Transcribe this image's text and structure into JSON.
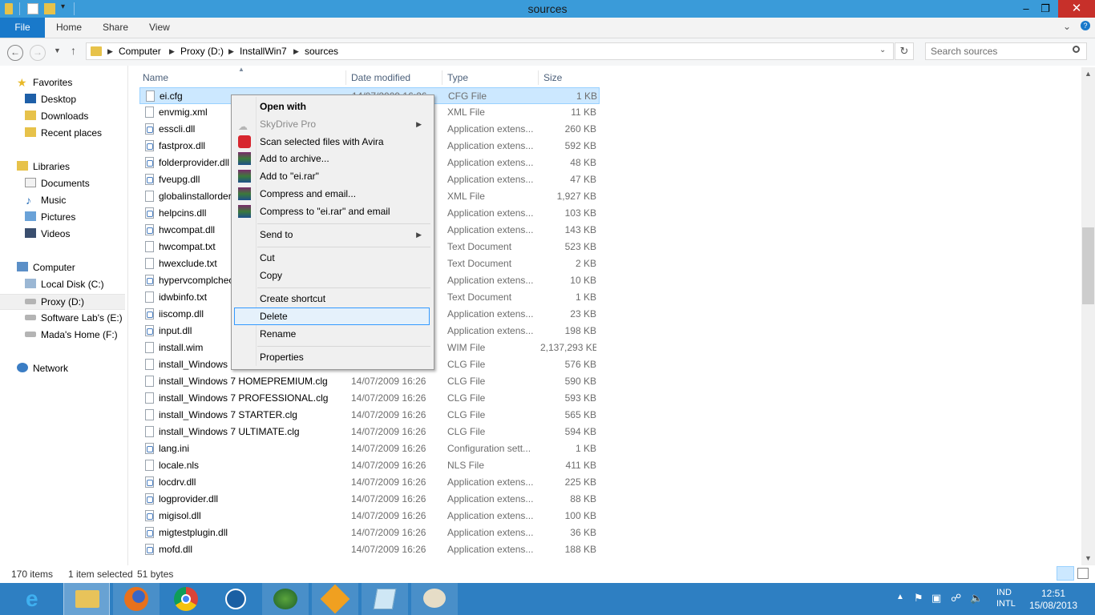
{
  "window": {
    "title": "sources"
  },
  "ribbon": {
    "tabs": [
      "File",
      "Home",
      "Share",
      "View"
    ]
  },
  "address": {
    "crumbs": [
      "Computer",
      "Proxy (D:)",
      "InstallWin7",
      "sources"
    ],
    "search_placeholder": "Search sources"
  },
  "nav": {
    "favorites_label": "Favorites",
    "favorites": [
      "Desktop",
      "Downloads",
      "Recent places"
    ],
    "libraries_label": "Libraries",
    "libraries": [
      "Documents",
      "Music",
      "Pictures",
      "Videos"
    ],
    "computer_label": "Computer",
    "drives": [
      "Local Disk (C:)",
      "Proxy (D:)",
      "Software Lab's (E:)",
      "Mada's Home (F:)"
    ],
    "network_label": "Network"
  },
  "columns": {
    "name": "Name",
    "date": "Date modified",
    "type": "Type",
    "size": "Size"
  },
  "files": [
    {
      "name": "ei.cfg",
      "date": "14/07/2009 16:26",
      "type": "CFG File",
      "size": "1 KB",
      "icon": "doc"
    },
    {
      "name": "envmig.xml",
      "date": "",
      "type": "XML File",
      "size": "11 KB",
      "icon": "doc"
    },
    {
      "name": "esscli.dll",
      "date": "",
      "type": "Application extens...",
      "size": "260 KB",
      "icon": "app"
    },
    {
      "name": "fastprox.dll",
      "date": "",
      "type": "Application extens...",
      "size": "592 KB",
      "icon": "app"
    },
    {
      "name": "folderprovider.dll",
      "date": "",
      "type": "Application extens...",
      "size": "48 KB",
      "icon": "app"
    },
    {
      "name": "fveupg.dll",
      "date": "",
      "type": "Application extens...",
      "size": "47 KB",
      "icon": "app"
    },
    {
      "name": "globalinstallorder.xml",
      "date": "",
      "type": "XML File",
      "size": "1,927 KB",
      "icon": "doc"
    },
    {
      "name": "helpcins.dll",
      "date": "",
      "type": "Application extens...",
      "size": "103 KB",
      "icon": "app"
    },
    {
      "name": "hwcompat.dll",
      "date": "",
      "type": "Application extens...",
      "size": "143 KB",
      "icon": "app"
    },
    {
      "name": "hwcompat.txt",
      "date": "",
      "type": "Text Document",
      "size": "523 KB",
      "icon": "doc"
    },
    {
      "name": "hwexclude.txt",
      "date": "",
      "type": "Text Document",
      "size": "2 KB",
      "icon": "doc"
    },
    {
      "name": "hypervcomplcheck.dll",
      "date": "",
      "type": "Application extens...",
      "size": "10 KB",
      "icon": "app"
    },
    {
      "name": "idwbinfo.txt",
      "date": "",
      "type": "Text Document",
      "size": "1 KB",
      "icon": "doc"
    },
    {
      "name": "iiscomp.dll",
      "date": "",
      "type": "Application extens...",
      "size": "23 KB",
      "icon": "app"
    },
    {
      "name": "input.dll",
      "date": "",
      "type": "Application extens...",
      "size": "198 KB",
      "icon": "app"
    },
    {
      "name": "install.wim",
      "date": "",
      "type": "WIM File",
      "size": "2,137,293 KB",
      "icon": "doc"
    },
    {
      "name": "install_Windows 7 HOMEBASIC.clg",
      "date": "",
      "type": "CLG File",
      "size": "576 KB",
      "icon": "doc"
    },
    {
      "name": "install_Windows 7 HOMEPREMIUM.clg",
      "date": "14/07/2009 16:26",
      "type": "CLG File",
      "size": "590 KB",
      "icon": "doc"
    },
    {
      "name": "install_Windows 7 PROFESSIONAL.clg",
      "date": "14/07/2009 16:26",
      "type": "CLG File",
      "size": "593 KB",
      "icon": "doc"
    },
    {
      "name": "install_Windows 7 STARTER.clg",
      "date": "14/07/2009 16:26",
      "type": "CLG File",
      "size": "565 KB",
      "icon": "doc"
    },
    {
      "name": "install_Windows 7 ULTIMATE.clg",
      "date": "14/07/2009 16:26",
      "type": "CLG File",
      "size": "594 KB",
      "icon": "doc"
    },
    {
      "name": "lang.ini",
      "date": "14/07/2009 16:26",
      "type": "Configuration sett...",
      "size": "1 KB",
      "icon": "app"
    },
    {
      "name": "locale.nls",
      "date": "14/07/2009 16:26",
      "type": "NLS File",
      "size": "411 KB",
      "icon": "doc"
    },
    {
      "name": "locdrv.dll",
      "date": "14/07/2009 16:26",
      "type": "Application extens...",
      "size": "225 KB",
      "icon": "app"
    },
    {
      "name": "logprovider.dll",
      "date": "14/07/2009 16:26",
      "type": "Application extens...",
      "size": "88 KB",
      "icon": "app"
    },
    {
      "name": "migisol.dll",
      "date": "14/07/2009 16:26",
      "type": "Application extens...",
      "size": "100 KB",
      "icon": "app"
    },
    {
      "name": "migtestplugin.dll",
      "date": "14/07/2009 16:26",
      "type": "Application extens...",
      "size": "36 KB",
      "icon": "app"
    },
    {
      "name": "mofd.dll",
      "date": "14/07/2009 16:26",
      "type": "Application extens...",
      "size": "188 KB",
      "icon": "app"
    }
  ],
  "context_menu": {
    "open_with": "Open with",
    "skydrive": "SkyDrive Pro",
    "scan": "Scan selected files with Avira",
    "add_archive": "Add to archive...",
    "add_rar": "Add to \"ei.rar\"",
    "compress_email": "Compress and email...",
    "compress_rar_email": "Compress to \"ei.rar\" and email",
    "send_to": "Send to",
    "cut": "Cut",
    "copy": "Copy",
    "create_shortcut": "Create shortcut",
    "delete": "Delete",
    "rename": "Rename",
    "properties": "Properties"
  },
  "status": {
    "items": "170 items",
    "selected": "1 item selected",
    "size": "51 bytes"
  },
  "tray": {
    "lang_top": "IND",
    "lang_bottom": "INTL",
    "time": "12:51",
    "date": "15/08/2013"
  },
  "colors": {
    "titlebar": "#3a9bd9",
    "file_tab": "#1979ca",
    "taskbar": "#2e7fc2",
    "selection": "#cce8ff",
    "close": "#c7302a"
  }
}
